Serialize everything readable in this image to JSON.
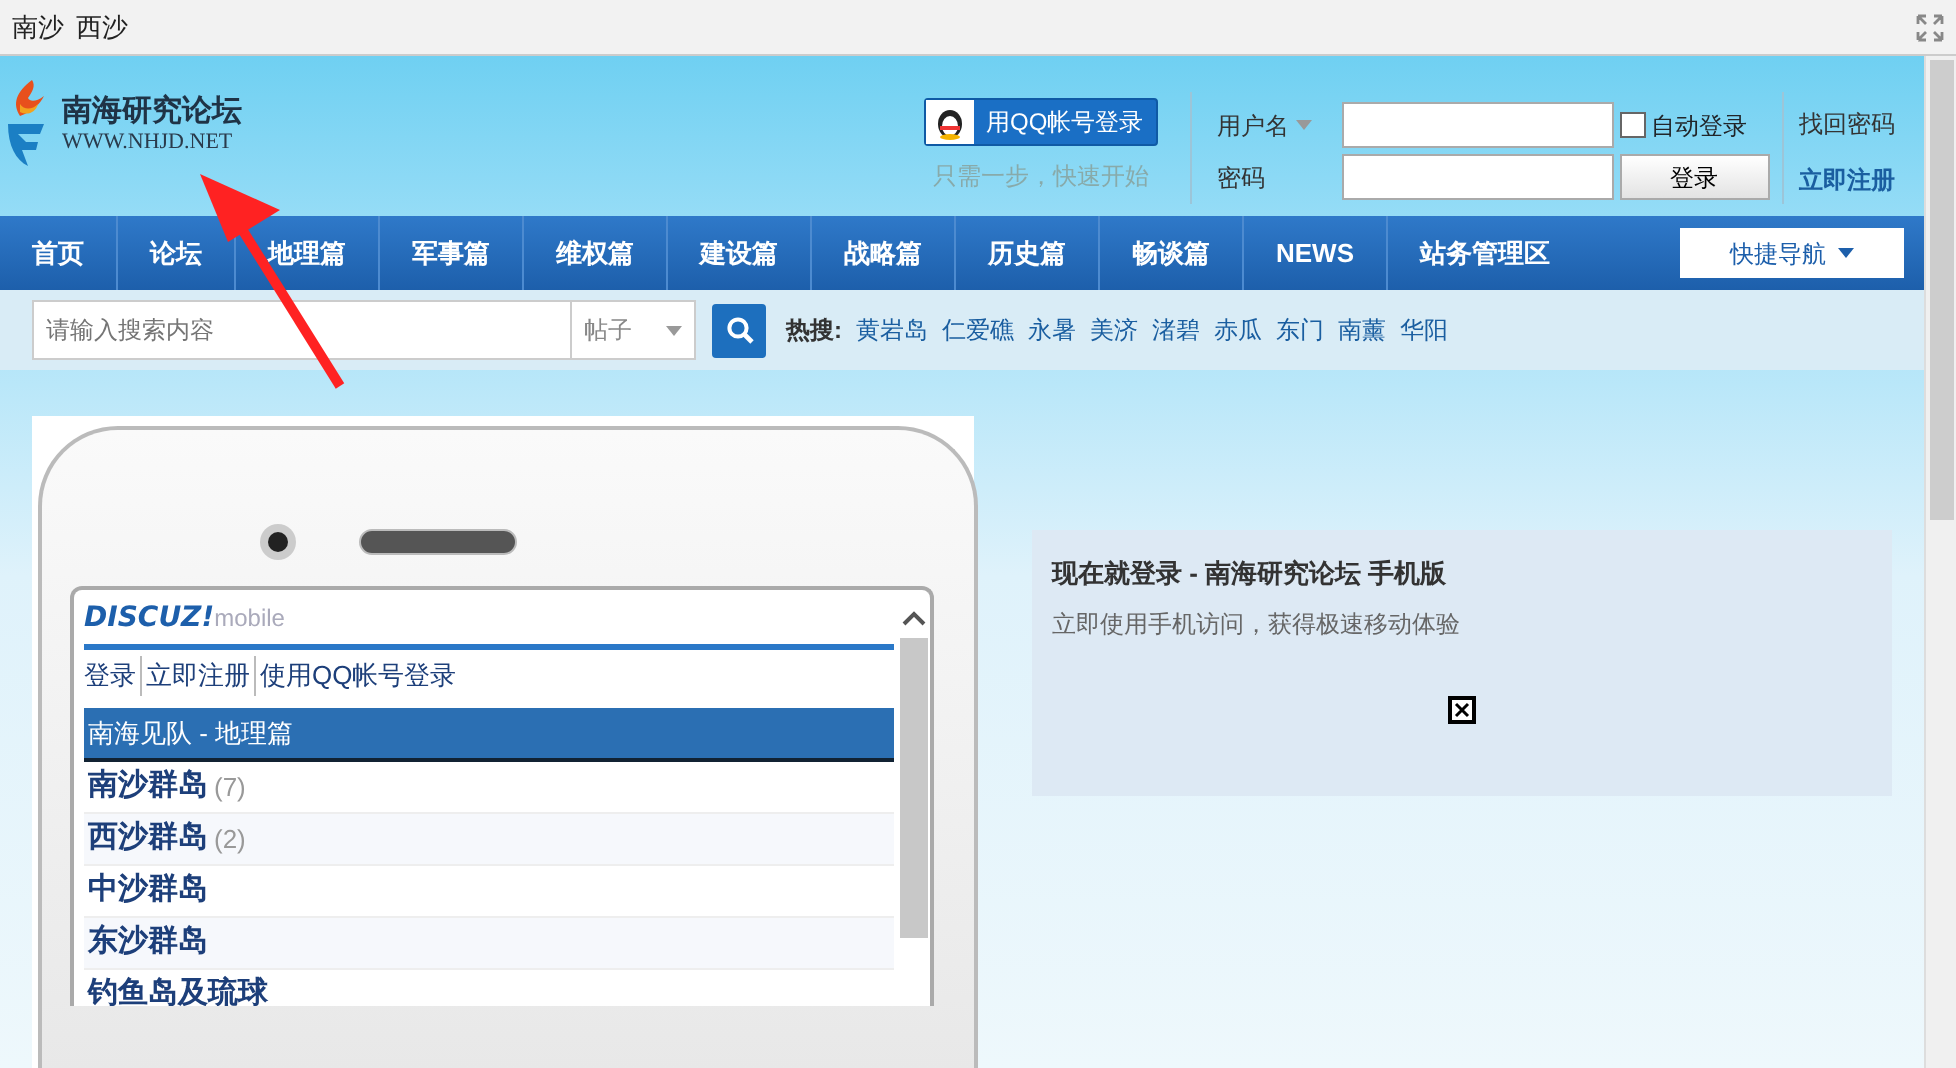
{
  "window": {
    "title_items": [
      "南沙",
      "西沙"
    ]
  },
  "header": {
    "logo_title": "南海研究论坛",
    "logo_url": "WWW.NHJD.NET",
    "qq_button": "用QQ帐号登录",
    "qq_hint": "只需一步，快速开始",
    "username_label": "用户名",
    "password_label": "密码",
    "auto_login": {
      "label": "自动登录",
      "checked": false
    },
    "login_button": "登录",
    "links": [
      "找回密码",
      "立即注册"
    ]
  },
  "nav": {
    "items": [
      "首页",
      "论坛",
      "地理篇",
      "军事篇",
      "维权篇",
      "建设篇",
      "战略篇",
      "历史篇",
      "畅谈篇",
      "NEWS",
      "站务管理区"
    ],
    "quick_nav": "快捷导航"
  },
  "search": {
    "placeholder": "请输入搜索内容",
    "scope": "帖子",
    "hot_label": "热搜:",
    "hot_terms": [
      "黄岩岛",
      "仁爱礁",
      "永暑",
      "美济",
      "渚碧",
      "赤瓜",
      "东门",
      "南薰",
      "华阳"
    ]
  },
  "phone": {
    "brand": "DISCUZ!",
    "brand_suffix": "mobile",
    "links": [
      "登录",
      "立即注册",
      "使用QQ帐号登录"
    ],
    "section": "南海见队 - 地理篇",
    "forums": [
      {
        "name": "南沙群岛",
        "count": "(7)"
      },
      {
        "name": "西沙群岛",
        "count": "(2)"
      },
      {
        "name": "中沙群岛"
      },
      {
        "name": "东沙群岛"
      },
      {
        "name": "钓鱼岛及琉球"
      }
    ]
  },
  "promo": {
    "title": "现在就登录 - 南海研究论坛 手机版",
    "subtitle": "立即使用手机访问，获得极速移动体验"
  }
}
